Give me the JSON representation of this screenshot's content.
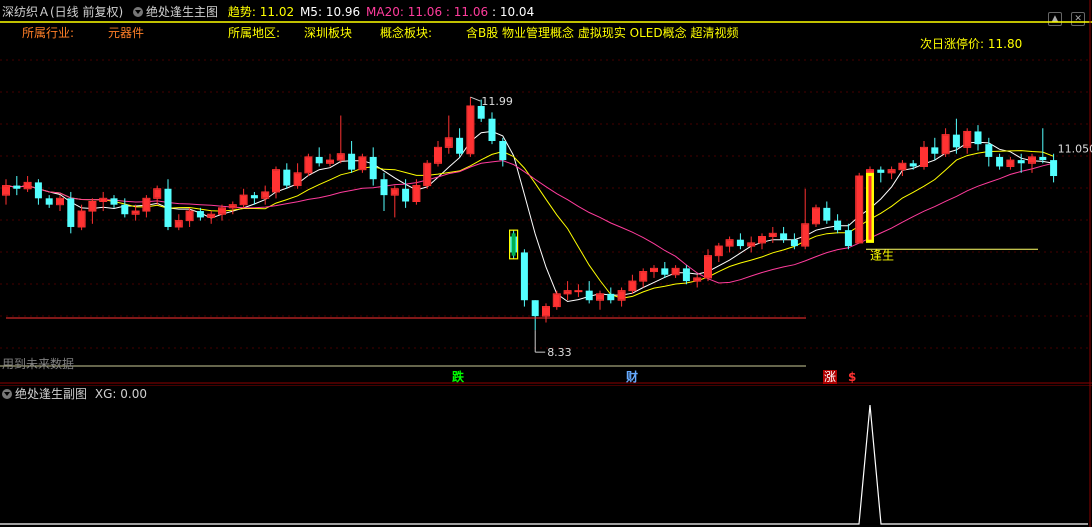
{
  "header": {
    "stock_name": "深纺织Ａ(日线 前复权)",
    "indicator_name": "绝处逢生主图",
    "trend_label": "趋势",
    "trend_value": "11.02",
    "m5_label": "M5",
    "m5_value": "10.96",
    "ma20_label": "MA20",
    "ma20_value1": "11.06",
    "ma20_value2": "11.06",
    "ma20_value3": "10.04"
  },
  "info": {
    "industry_label": "所属行业:",
    "industry_value": "元器件",
    "region_label": "所属地区:",
    "region_value": "深圳板块",
    "concept_label": "概念板块:",
    "concept_value": "含B股 物业管理概念 虚拟现实 OLED概念 超清视频",
    "limit_label": "次日涨停价:",
    "limit_value": "11.80"
  },
  "annotations": {
    "high_label": "11.99",
    "low_label": "8.33",
    "last_price": "11.050",
    "signal_label": "逢生",
    "future_data": "用到未来数据",
    "marker_die": "跌",
    "marker_cai": "财",
    "marker_zhang": "涨",
    "marker_s": "$"
  },
  "sub_panel": {
    "title": "绝处逢生副图",
    "xg_label": "XG",
    "xg_value": "0.00"
  },
  "colors": {
    "up": "#ff3232",
    "down": "#54ffff",
    "ma5": "#ffffff",
    "ma10": "#ffff00",
    "ma20": "#ff3c9c",
    "grid": "#8b0000"
  },
  "chart_data": {
    "type": "candlestick",
    "price_axis_range": [
      7.5,
      13.2
    ],
    "candles": [
      [
        10.45,
        10.7,
        10.3,
        10.6
      ],
      [
        10.6,
        10.75,
        10.45,
        10.55
      ],
      [
        10.55,
        10.75,
        10.5,
        10.65
      ],
      [
        10.65,
        10.7,
        10.3,
        10.4
      ],
      [
        10.4,
        10.45,
        10.25,
        10.3
      ],
      [
        10.3,
        10.45,
        10.2,
        10.4
      ],
      [
        10.4,
        10.5,
        9.85,
        9.95
      ],
      [
        9.95,
        10.3,
        9.9,
        10.2
      ],
      [
        10.2,
        10.4,
        10.0,
        10.35
      ],
      [
        10.35,
        10.5,
        10.2,
        10.4
      ],
      [
        10.4,
        10.45,
        10.25,
        10.3
      ],
      [
        10.3,
        10.4,
        10.1,
        10.15
      ],
      [
        10.15,
        10.3,
        10.05,
        10.2
      ],
      [
        10.2,
        10.45,
        10.1,
        10.4
      ],
      [
        10.4,
        10.6,
        10.3,
        10.55
      ],
      [
        10.55,
        10.7,
        9.9,
        9.95
      ],
      [
        9.95,
        10.15,
        9.9,
        10.05
      ],
      [
        10.05,
        10.25,
        9.95,
        10.2
      ],
      [
        10.2,
        10.25,
        10.05,
        10.1
      ],
      [
        10.1,
        10.2,
        10.0,
        10.15
      ],
      [
        10.15,
        10.3,
        10.05,
        10.25
      ],
      [
        10.25,
        10.35,
        10.15,
        10.3
      ],
      [
        10.3,
        10.55,
        10.25,
        10.45
      ],
      [
        10.45,
        10.5,
        10.3,
        10.4
      ],
      [
        10.4,
        10.6,
        10.3,
        10.5
      ],
      [
        10.5,
        10.9,
        10.4,
        10.85
      ],
      [
        10.85,
        10.95,
        10.55,
        10.6
      ],
      [
        10.6,
        10.95,
        10.55,
        10.8
      ],
      [
        10.8,
        11.1,
        10.75,
        11.05
      ],
      [
        11.05,
        11.2,
        10.9,
        10.95
      ],
      [
        10.95,
        11.1,
        10.9,
        11.0
      ],
      [
        11.0,
        11.7,
        10.95,
        11.1
      ],
      [
        11.1,
        11.3,
        10.8,
        10.85
      ],
      [
        10.85,
        11.1,
        10.8,
        11.05
      ],
      [
        11.05,
        11.2,
        10.6,
        10.7
      ],
      [
        10.7,
        10.8,
        10.2,
        10.45
      ],
      [
        10.45,
        10.6,
        10.1,
        10.55
      ],
      [
        10.55,
        10.7,
        10.25,
        10.35
      ],
      [
        10.35,
        10.7,
        10.3,
        10.6
      ],
      [
        10.6,
        11.0,
        10.55,
        10.95
      ],
      [
        10.95,
        11.3,
        10.9,
        11.2
      ],
      [
        11.2,
        11.7,
        11.1,
        11.35
      ],
      [
        11.35,
        11.5,
        11.05,
        11.1
      ],
      [
        11.1,
        11.99,
        11.05,
        11.85
      ],
      [
        11.85,
        11.95,
        11.6,
        11.65
      ],
      [
        11.65,
        11.75,
        11.25,
        11.3
      ],
      [
        11.3,
        11.35,
        10.9,
        11.0
      ],
      [
        9.8,
        9.9,
        9.45,
        9.55
      ],
      [
        9.55,
        9.6,
        8.7,
        8.8
      ],
      [
        8.8,
        8.8,
        8.33,
        8.55
      ],
      [
        8.55,
        8.75,
        8.45,
        8.7
      ],
      [
        8.7,
        8.95,
        8.65,
        8.9
      ],
      [
        8.9,
        9.1,
        8.8,
        8.95
      ],
      [
        8.95,
        9.05,
        8.85,
        8.95
      ],
      [
        8.95,
        9.1,
        8.75,
        8.8
      ],
      [
        8.8,
        8.95,
        8.65,
        8.9
      ],
      [
        8.9,
        9.0,
        8.75,
        8.8
      ],
      [
        8.8,
        9.0,
        8.7,
        8.95
      ],
      [
        8.95,
        9.2,
        8.9,
        9.1
      ],
      [
        9.1,
        9.3,
        9.0,
        9.25
      ],
      [
        9.25,
        9.35,
        9.15,
        9.3
      ],
      [
        9.3,
        9.4,
        9.15,
        9.2
      ],
      [
        9.2,
        9.35,
        9.15,
        9.3
      ],
      [
        9.3,
        9.35,
        9.05,
        9.1
      ],
      [
        9.1,
        9.2,
        9.0,
        9.15
      ],
      [
        9.15,
        9.6,
        9.1,
        9.5
      ],
      [
        9.5,
        9.7,
        9.4,
        9.65
      ],
      [
        9.65,
        9.8,
        9.55,
        9.75
      ],
      [
        9.75,
        9.85,
        9.6,
        9.65
      ],
      [
        9.65,
        9.8,
        9.55,
        9.7
      ],
      [
        9.7,
        9.85,
        9.6,
        9.8
      ],
      [
        9.8,
        9.95,
        9.7,
        9.85
      ],
      [
        9.85,
        9.95,
        9.7,
        9.75
      ],
      [
        9.75,
        9.85,
        9.6,
        9.65
      ],
      [
        9.65,
        10.55,
        9.6,
        10.0
      ],
      [
        10.0,
        10.3,
        9.95,
        10.25
      ],
      [
        10.25,
        10.35,
        10.0,
        10.05
      ],
      [
        10.05,
        10.15,
        9.85,
        9.9
      ],
      [
        9.9,
        10.0,
        9.6,
        9.65
      ],
      [
        9.7,
        10.8,
        9.7,
        10.75
      ],
      [
        10.75,
        10.9,
        10.7,
        10.85
      ],
      [
        10.85,
        10.9,
        10.65,
        10.8
      ],
      [
        10.8,
        10.9,
        10.7,
        10.85
      ],
      [
        10.85,
        11.0,
        10.75,
        10.95
      ],
      [
        10.95,
        11.0,
        10.85,
        10.9
      ],
      [
        10.9,
        11.3,
        10.85,
        11.2
      ],
      [
        11.2,
        11.35,
        11.0,
        11.1
      ],
      [
        11.1,
        11.5,
        11.05,
        11.4
      ],
      [
        11.4,
        11.65,
        11.1,
        11.2
      ],
      [
        11.2,
        11.5,
        11.1,
        11.45
      ],
      [
        11.45,
        11.55,
        11.15,
        11.25
      ],
      [
        11.25,
        11.35,
        10.9,
        11.05
      ],
      [
        11.05,
        11.1,
        10.85,
        10.9
      ],
      [
        10.9,
        11.05,
        10.85,
        11.0
      ],
      [
        11.0,
        11.1,
        10.8,
        10.95
      ],
      [
        10.95,
        11.1,
        10.8,
        11.05
      ],
      [
        11.05,
        11.5,
        10.95,
        11.0
      ],
      [
        11.0,
        11.1,
        10.65,
        10.75
      ]
    ],
    "high_marker": 11.99,
    "low_marker": 8.33,
    "signal_bar_index": 79,
    "signal_level": 9.6,
    "sub_signal_bar_index": 79,
    "sub_signal_value": 1
  }
}
